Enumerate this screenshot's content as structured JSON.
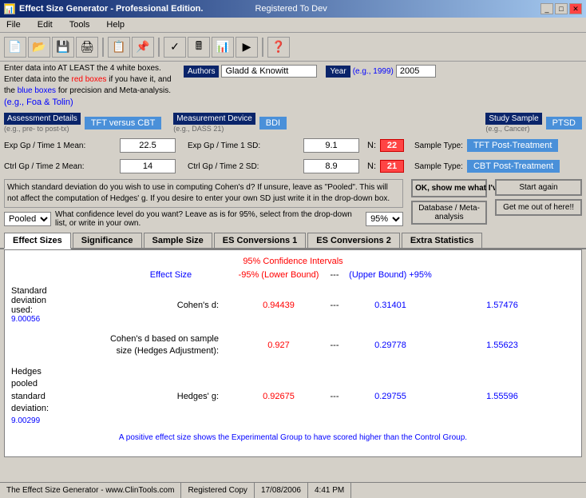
{
  "titleBar": {
    "icon": "ES",
    "title": "Effect Size Generator - Professional Edition.",
    "registered": "Registered To Dev",
    "buttons": [
      "_",
      "□",
      "✕"
    ]
  },
  "menuBar": {
    "items": [
      "File",
      "Edit",
      "Tools",
      "Help"
    ]
  },
  "infoText": {
    "main": "Enter data into AT LEAST the 4 white boxes. Enter data into the red boxes if you have it, and the blue boxes for precision and Meta-analysis.",
    "eg1": "(e.g., Foa & Tolin)"
  },
  "authorsLabel": "Authors",
  "authorsEg": "(e.g., Foa & Tolin)",
  "authorsValue": "Gladd & Knowitt",
  "yearLabel": "Year",
  "yearEg": "(e.g., 1999)",
  "yearValue": "2005",
  "assessment": {
    "label": "Assessment Details",
    "sublabel": "(e.g., pre- to post-tx)",
    "value": "TFT versus CBT"
  },
  "measurement": {
    "label": "Measurement Device",
    "sublabel": "(e.g., DASS 21)",
    "value": "BDI"
  },
  "studySample": {
    "label": "Study Sample",
    "sublabel": "(e.g., Cancer)",
    "value": "PTSD"
  },
  "expRow": {
    "label": "Exp Gp / Time 1 Mean:",
    "value": "22.5",
    "sdLabel": "Exp Gp / Time 1 SD:",
    "sdValue": "9.1",
    "nLabel": "N:",
    "nValue": "22",
    "sampleTypeLabel": "Sample Type:",
    "sampleTypeValue": "TFT Post-Treatment"
  },
  "ctrlRow": {
    "label": "Ctrl Gp / Time 2 Mean:",
    "value": "14",
    "sdLabel": "Ctrl Gp / Time 2 SD:",
    "sdValue": "8.9",
    "nLabel": "N:",
    "nValue": "21",
    "sampleTypeLabel": "Sample Type:",
    "sampleTypeValue": "CBT Post-Treatment"
  },
  "sdQuestion": "Which standard deviation do you wish to use in computing Cohen's d? If unsure, leave as \"Pooled\". This will not affect the computation of Hedges' g. If you desire to enter your own SD just write it in the drop-down box.",
  "sdOptions": [
    "Pooled"
  ],
  "sdSelected": "Pooled",
  "confQuestion": "What confidence level do you want? Leave as is for 95%, select from the drop-down list, or write in your own.",
  "confOptions": [
    "95%"
  ],
  "confSelected": "95%",
  "okBtn": "OK, show me what I've got!",
  "startBtn": "Start again",
  "dbBtn": "Database / Meta-analysis",
  "getOutBtn": "Get me out of here!!",
  "tabs": [
    {
      "label": "Effect Sizes",
      "active": true
    },
    {
      "label": "Significance",
      "active": false
    },
    {
      "label": "Sample Size",
      "active": false
    },
    {
      "label": "ES Conversions 1",
      "active": false
    },
    {
      "label": "ES Conversions 2",
      "active": false
    },
    {
      "label": "Extra Statistics",
      "active": false
    }
  ],
  "effectSizes": {
    "ciHeader": "95% Confidence Intervals",
    "colHeaders": {
      "effectSize": "Effect Size",
      "lowerLabel": "-95% (Lower Bound)",
      "dash": "---",
      "upperLabel": "(Upper Bound) +95%"
    },
    "rows": [
      {
        "groupLabel": "Standard\ndeviation\nused:",
        "sdValue": "9.00056",
        "name": "Cohen's d:",
        "value": "0.94439",
        "lower": "0.31401",
        "upper": "1.57476"
      },
      {
        "groupLabel": "",
        "sdValue": "",
        "name": "Cohen's d based on sample\nsize (Hedges Adjustment):",
        "value": "0.927",
        "lower": "0.29778",
        "upper": "1.55623"
      },
      {
        "groupLabel": "Hedges\npooled\nstandard\ndeviation:",
        "sdValue": "9.00299",
        "name": "Hedges' g:",
        "value": "0.92675",
        "lower": "0.29755",
        "upper": "1.55596"
      }
    ],
    "bottomNote": "A positive effect size shows the Experimental Group to have scored higher than the Control Group."
  },
  "statusBar": {
    "website": "The Effect Size Generator - www.ClinTools.com",
    "copy": "Registered Copy",
    "date": "17/08/2006",
    "time": "4:41 PM"
  }
}
